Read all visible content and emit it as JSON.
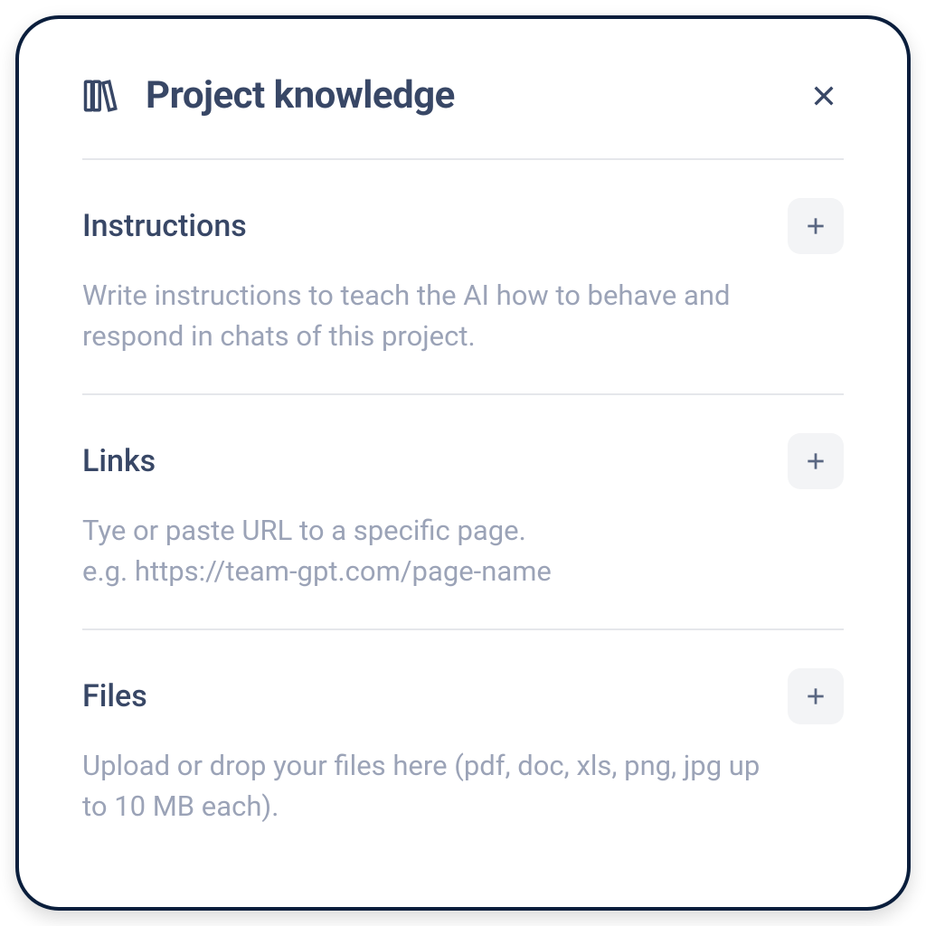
{
  "modal": {
    "title": "Project knowledge"
  },
  "sections": {
    "instructions": {
      "title": "Instructions",
      "description": "Write instructions to teach the AI how to behave and respond in chats of this project."
    },
    "links": {
      "title": "Links",
      "description": "Tye or paste URL to a specific page.\ne.g. https://team-gpt.com/page-name"
    },
    "files": {
      "title": "Files",
      "description": "Upload or drop your files here (pdf, doc, xls, png, jpg up to 10 MB each)."
    }
  }
}
